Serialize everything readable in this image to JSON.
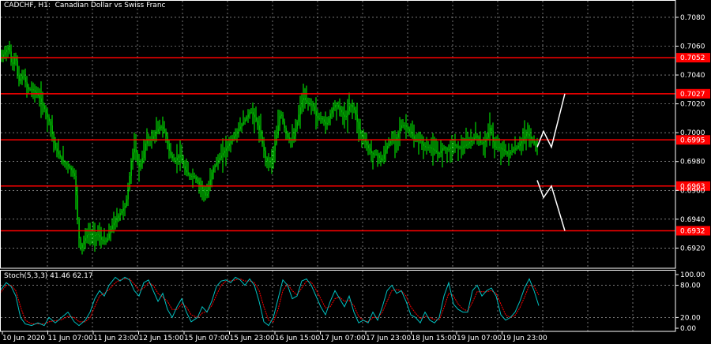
{
  "header": {
    "title": "CADCHF, H1:  Canadian Dollar vs Swiss Franc"
  },
  "stochastic": {
    "label": "Stoch(5,3,3) 41.46 62.17",
    "levels": [
      "100.00",
      "80.00",
      "20.00",
      "0.00"
    ]
  },
  "colors": {
    "background": "#000000",
    "grid": "#c0c0c0",
    "candles": "#00ff00",
    "level_lines": "#ff0000",
    "level_label_bg": "#ff0000",
    "projection": "#ffffff",
    "stoch_main": "#00c0c0",
    "stoch_signal": "#ff0000"
  },
  "chart_data": {
    "type": "candlestick",
    "symbol": "CADCHF",
    "timeframe": "H1",
    "ylim": [
      0.6906,
      0.7092
    ],
    "price_ticks": [
      "0.7080",
      "0.7060",
      "0.7040",
      "0.7020",
      "0.7000",
      "0.6980",
      "0.6960",
      "0.6940",
      "0.6920"
    ],
    "time_labels": [
      "10 Jun 2020",
      "11 Jun 07:00",
      "11 Jun 23:00",
      "12 Jun 15:00",
      "15 Jun 07:00",
      "15 Jun 23:00",
      "16 Jun 15:00",
      "17 Jun 07:00",
      "17 Jun 23:00",
      "18 Jun 15:00",
      "19 Jun 07:00",
      "19 Jun 23:00"
    ],
    "levels": [
      {
        "value": 0.7052,
        "label": "0.7052"
      },
      {
        "value": 0.7027,
        "label": "0.7027"
      },
      {
        "value": 0.6995,
        "label": "0.6995"
      },
      {
        "value": 0.6963,
        "label": "0.6963"
      },
      {
        "value": 0.6932,
        "label": "0.6932"
      }
    ],
    "close_path": [
      [
        0,
        0.705
      ],
      [
        6,
        0.7055
      ],
      [
        12,
        0.706
      ],
      [
        16,
        0.7045
      ],
      [
        20,
        0.7055
      ],
      [
        24,
        0.7035
      ],
      [
        30,
        0.704
      ],
      [
        36,
        0.703
      ],
      [
        42,
        0.703
      ],
      [
        50,
        0.7025
      ],
      [
        58,
        0.7015
      ],
      [
        65,
        0.7005
      ],
      [
        70,
        0.699
      ],
      [
        75,
        0.6985
      ],
      [
        80,
        0.698
      ],
      [
        85,
        0.6978
      ],
      [
        90,
        0.6975
      ],
      [
        95,
        0.697
      ],
      [
        98,
        0.695
      ],
      [
        100,
        0.693
      ],
      [
        103,
        0.692
      ],
      [
        107,
        0.6925
      ],
      [
        112,
        0.693
      ],
      [
        118,
        0.6928
      ],
      [
        124,
        0.693
      ],
      [
        130,
        0.6925
      ],
      [
        136,
        0.6925
      ],
      [
        142,
        0.6935
      ],
      [
        148,
        0.694
      ],
      [
        154,
        0.6945
      ],
      [
        160,
        0.695
      ],
      [
        164,
        0.6965
      ],
      [
        168,
        0.6985
      ],
      [
        172,
        0.699
      ],
      [
        176,
        0.6975
      ],
      [
        180,
        0.698
      ],
      [
        186,
        0.6995
      ],
      [
        192,
        0.6995
      ],
      [
        198,
        0.7
      ],
      [
        204,
        0.7005
      ],
      [
        210,
        0.7
      ],
      [
        216,
        0.6985
      ],
      [
        222,
        0.698
      ],
      [
        228,
        0.6985
      ],
      [
        234,
        0.6975
      ],
      [
        240,
        0.697
      ],
      [
        246,
        0.697
      ],
      [
        252,
        0.6965
      ],
      [
        258,
        0.696
      ],
      [
        262,
        0.6955
      ],
      [
        266,
        0.6965
      ],
      [
        270,
        0.6975
      ],
      [
        276,
        0.698
      ],
      [
        282,
        0.6985
      ],
      [
        288,
        0.699
      ],
      [
        294,
        0.6995
      ],
      [
        300,
        0.7
      ],
      [
        306,
        0.7005
      ],
      [
        312,
        0.701
      ],
      [
        318,
        0.7015
      ],
      [
        324,
        0.701
      ],
      [
        330,
        0.7
      ],
      [
        334,
        0.699
      ],
      [
        338,
        0.698
      ],
      [
        344,
        0.698
      ],
      [
        350,
        0.6995
      ],
      [
        356,
        0.7015
      ],
      [
        360,
        0.7005
      ],
      [
        366,
        0.6995
      ],
      [
        372,
        0.6995
      ],
      [
        378,
        0.701
      ],
      [
        384,
        0.7025
      ],
      [
        390,
        0.702
      ],
      [
        396,
        0.702
      ],
      [
        402,
        0.701
      ],
      [
        408,
        0.701
      ],
      [
        414,
        0.7005
      ],
      [
        420,
        0.7015
      ],
      [
        426,
        0.702
      ],
      [
        432,
        0.7015
      ],
      [
        438,
        0.701
      ],
      [
        444,
        0.702
      ],
      [
        450,
        0.7015
      ],
      [
        456,
        0.7
      ],
      [
        462,
        0.6995
      ],
      [
        466,
        0.699
      ],
      [
        472,
        0.6985
      ],
      [
        478,
        0.6985
      ],
      [
        484,
        0.698
      ],
      [
        490,
        0.699
      ],
      [
        496,
        0.6995
      ],
      [
        502,
        0.6995
      ],
      [
        508,
        0.7005
      ],
      [
        514,
        0.7005
      ],
      [
        520,
        0.7
      ],
      [
        526,
        0.6995
      ],
      [
        532,
        0.6995
      ],
      [
        538,
        0.699
      ],
      [
        544,
        0.699
      ],
      [
        550,
        0.6988
      ],
      [
        556,
        0.6985
      ],
      [
        562,
        0.699
      ],
      [
        568,
        0.6988
      ],
      [
        574,
        0.6992
      ],
      [
        580,
        0.699
      ],
      [
        586,
        0.699
      ],
      [
        592,
        0.6992
      ],
      [
        598,
        0.6995
      ],
      [
        604,
        0.6998
      ],
      [
        610,
        0.6992
      ],
      [
        616,
        0.6995
      ],
      [
        622,
        0.7005
      ],
      [
        626,
        0.699
      ],
      [
        632,
        0.699
      ],
      [
        638,
        0.6988
      ],
      [
        644,
        0.6985
      ],
      [
        650,
        0.6988
      ],
      [
        656,
        0.699
      ],
      [
        662,
        0.6995
      ],
      [
        668,
        0.7
      ],
      [
        674,
        0.6995
      ],
      [
        680,
        0.699
      ]
    ],
    "projection_up": [
      [
        680,
        0.699
      ],
      [
        688,
        0.7001
      ],
      [
        698,
        0.699
      ],
      [
        715,
        0.7027
      ]
    ],
    "projection_down": [
      [
        680,
        0.6967
      ],
      [
        688,
        0.6955
      ],
      [
        698,
        0.6963
      ],
      [
        715,
        0.6932
      ]
    ],
    "stoch_main": [
      [
        0,
        70
      ],
      [
        8,
        85
      ],
      [
        14,
        78
      ],
      [
        20,
        60
      ],
      [
        26,
        20
      ],
      [
        32,
        8
      ],
      [
        40,
        5
      ],
      [
        48,
        10
      ],
      [
        56,
        5
      ],
      [
        62,
        20
      ],
      [
        70,
        10
      ],
      [
        78,
        20
      ],
      [
        86,
        30
      ],
      [
        94,
        12
      ],
      [
        100,
        5
      ],
      [
        108,
        15
      ],
      [
        114,
        30
      ],
      [
        120,
        55
      ],
      [
        126,
        70
      ],
      [
        132,
        60
      ],
      [
        138,
        80
      ],
      [
        146,
        95
      ],
      [
        152,
        88
      ],
      [
        158,
        95
      ],
      [
        164,
        90
      ],
      [
        170,
        70
      ],
      [
        176,
        60
      ],
      [
        182,
        85
      ],
      [
        188,
        90
      ],
      [
        194,
        70
      ],
      [
        200,
        50
      ],
      [
        206,
        65
      ],
      [
        212,
        35
      ],
      [
        218,
        20
      ],
      [
        224,
        40
      ],
      [
        230,
        55
      ],
      [
        236,
        30
      ],
      [
        242,
        12
      ],
      [
        250,
        20
      ],
      [
        256,
        40
      ],
      [
        262,
        30
      ],
      [
        268,
        50
      ],
      [
        274,
        78
      ],
      [
        280,
        88
      ],
      [
        286,
        90
      ],
      [
        292,
        85
      ],
      [
        298,
        95
      ],
      [
        304,
        90
      ],
      [
        310,
        80
      ],
      [
        316,
        92
      ],
      [
        322,
        80
      ],
      [
        328,
        50
      ],
      [
        334,
        12
      ],
      [
        340,
        5
      ],
      [
        346,
        20
      ],
      [
        352,
        55
      ],
      [
        358,
        90
      ],
      [
        364,
        80
      ],
      [
        370,
        55
      ],
      [
        376,
        60
      ],
      [
        382,
        88
      ],
      [
        388,
        92
      ],
      [
        394,
        80
      ],
      [
        400,
        60
      ],
      [
        406,
        40
      ],
      [
        412,
        25
      ],
      [
        418,
        50
      ],
      [
        424,
        70
      ],
      [
        430,
        55
      ],
      [
        436,
        40
      ],
      [
        442,
        60
      ],
      [
        448,
        30
      ],
      [
        454,
        10
      ],
      [
        460,
        15
      ],
      [
        466,
        10
      ],
      [
        472,
        30
      ],
      [
        478,
        15
      ],
      [
        484,
        40
      ],
      [
        490,
        70
      ],
      [
        496,
        80
      ],
      [
        502,
        65
      ],
      [
        508,
        70
      ],
      [
        514,
        50
      ],
      [
        520,
        25
      ],
      [
        526,
        20
      ],
      [
        532,
        10
      ],
      [
        538,
        30
      ],
      [
        544,
        15
      ],
      [
        550,
        10
      ],
      [
        556,
        20
      ],
      [
        562,
        60
      ],
      [
        568,
        85
      ],
      [
        574,
        45
      ],
      [
        580,
        35
      ],
      [
        586,
        30
      ],
      [
        592,
        30
      ],
      [
        598,
        70
      ],
      [
        604,
        80
      ],
      [
        610,
        60
      ],
      [
        616,
        70
      ],
      [
        622,
        75
      ],
      [
        628,
        60
      ],
      [
        634,
        25
      ],
      [
        640,
        15
      ],
      [
        646,
        20
      ],
      [
        652,
        30
      ],
      [
        658,
        50
      ],
      [
        664,
        75
      ],
      [
        670,
        92
      ],
      [
        676,
        70
      ],
      [
        682,
        42
      ]
    ],
    "stoch_signal": [
      [
        0,
        65
      ],
      [
        8,
        80
      ],
      [
        14,
        80
      ],
      [
        20,
        70
      ],
      [
        26,
        40
      ],
      [
        32,
        15
      ],
      [
        40,
        8
      ],
      [
        48,
        8
      ],
      [
        56,
        8
      ],
      [
        62,
        12
      ],
      [
        70,
        14
      ],
      [
        78,
        16
      ],
      [
        86,
        22
      ],
      [
        94,
        20
      ],
      [
        100,
        12
      ],
      [
        108,
        12
      ],
      [
        114,
        20
      ],
      [
        120,
        40
      ],
      [
        126,
        60
      ],
      [
        132,
        65
      ],
      [
        138,
        72
      ],
      [
        146,
        85
      ],
      [
        152,
        90
      ],
      [
        158,
        92
      ],
      [
        164,
        92
      ],
      [
        170,
        82
      ],
      [
        176,
        70
      ],
      [
        182,
        75
      ],
      [
        188,
        85
      ],
      [
        194,
        80
      ],
      [
        200,
        65
      ],
      [
        206,
        58
      ],
      [
        212,
        50
      ],
      [
        218,
        35
      ],
      [
        224,
        35
      ],
      [
        230,
        45
      ],
      [
        236,
        40
      ],
      [
        242,
        25
      ],
      [
        250,
        20
      ],
      [
        256,
        28
      ],
      [
        262,
        32
      ],
      [
        268,
        42
      ],
      [
        274,
        62
      ],
      [
        280,
        80
      ],
      [
        286,
        88
      ],
      [
        292,
        88
      ],
      [
        298,
        90
      ],
      [
        304,
        92
      ],
      [
        310,
        88
      ],
      [
        316,
        88
      ],
      [
        322,
        85
      ],
      [
        328,
        70
      ],
      [
        334,
        40
      ],
      [
        340,
        15
      ],
      [
        346,
        12
      ],
      [
        352,
        35
      ],
      [
        358,
        70
      ],
      [
        364,
        82
      ],
      [
        370,
        70
      ],
      [
        376,
        62
      ],
      [
        382,
        75
      ],
      [
        388,
        88
      ],
      [
        394,
        86
      ],
      [
        400,
        72
      ],
      [
        406,
        55
      ],
      [
        412,
        38
      ],
      [
        418,
        40
      ],
      [
        424,
        55
      ],
      [
        430,
        58
      ],
      [
        436,
        50
      ],
      [
        442,
        52
      ],
      [
        448,
        42
      ],
      [
        454,
        22
      ],
      [
        460,
        14
      ],
      [
        466,
        12
      ],
      [
        472,
        20
      ],
      [
        478,
        20
      ],
      [
        484,
        30
      ],
      [
        490,
        50
      ],
      [
        496,
        70
      ],
      [
        502,
        72
      ],
      [
        508,
        70
      ],
      [
        514,
        60
      ],
      [
        520,
        40
      ],
      [
        526,
        28
      ],
      [
        532,
        18
      ],
      [
        538,
        22
      ],
      [
        544,
        20
      ],
      [
        550,
        16
      ],
      [
        556,
        16
      ],
      [
        562,
        38
      ],
      [
        568,
        65
      ],
      [
        574,
        60
      ],
      [
        580,
        45
      ],
      [
        586,
        36
      ],
      [
        592,
        32
      ],
      [
        598,
        48
      ],
      [
        604,
        68
      ],
      [
        610,
        68
      ],
      [
        616,
        68
      ],
      [
        622,
        70
      ],
      [
        628,
        65
      ],
      [
        634,
        45
      ],
      [
        640,
        25
      ],
      [
        646,
        20
      ],
      [
        652,
        24
      ],
      [
        658,
        38
      ],
      [
        664,
        58
      ],
      [
        670,
        80
      ],
      [
        676,
        78
      ],
      [
        682,
        62
      ]
    ]
  }
}
